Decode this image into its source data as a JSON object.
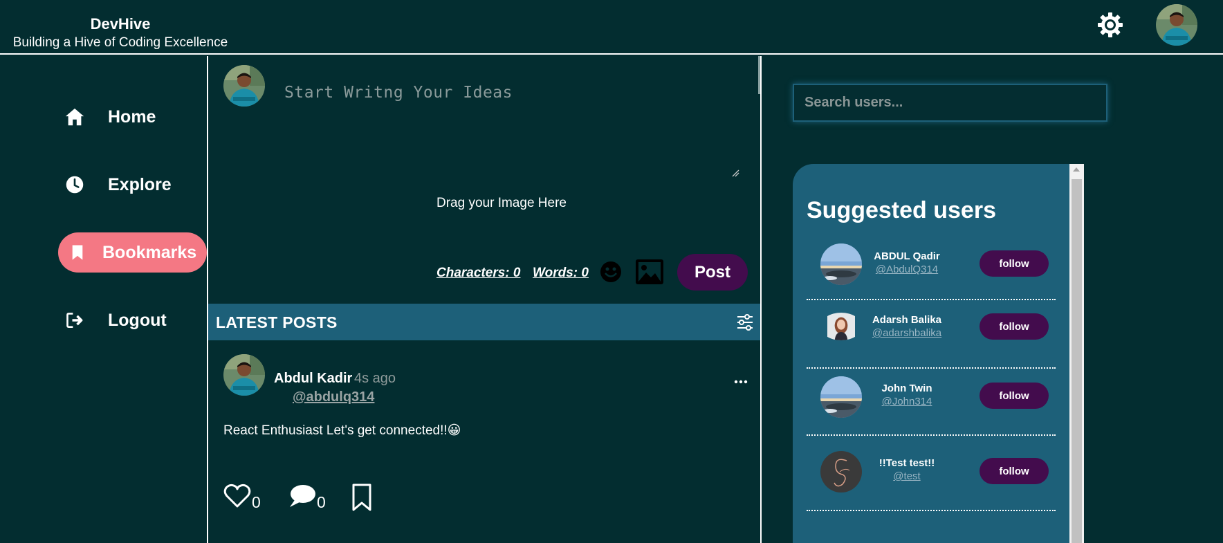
{
  "header": {
    "brand_name": "DevHive",
    "tagline": "Building a Hive of Coding Excellence",
    "settings_icon": "gear-icon",
    "profile_avatar": "user-avatar"
  },
  "sidebar": {
    "items": [
      {
        "label": "Home",
        "icon": "home-icon",
        "active": false
      },
      {
        "label": "Explore",
        "icon": "clock-icon",
        "active": false
      },
      {
        "label": "Bookmarks",
        "icon": "bookmark-icon",
        "active": true
      },
      {
        "label": "Logout",
        "icon": "logout-icon",
        "active": false
      }
    ],
    "active_color": "#f47884"
  },
  "composer": {
    "placeholder": "Start Writng Your Ideas",
    "drag_text": "Drag your Image Here",
    "characters": "Characters: 0",
    "words": "Words: 0",
    "post_label": "Post"
  },
  "feed": {
    "section_title": "LATEST POSTS",
    "posts": [
      {
        "author": "Abdul Kadir",
        "time": "4s ago",
        "handle": "@abdulq314",
        "text": "React Enthusiast Let's get connected!!😀",
        "likes": "0",
        "comments": "0"
      }
    ]
  },
  "search": {
    "placeholder": "Search users..."
  },
  "suggested": {
    "title": "Suggested users",
    "follow_label": "follow",
    "users": [
      {
        "name": "ABDUL Qadir",
        "handle": "@AbdulQ314",
        "avatar": "landscape-avatar"
      },
      {
        "name": "Adarsh Balika",
        "handle": "@adarshbalika",
        "avatar": "portrait-avatar"
      },
      {
        "name": "John Twin",
        "handle": "@John314",
        "avatar": "landscape-avatar"
      },
      {
        "name": "!!Test test!!",
        "handle": "@test",
        "avatar": "signature-avatar"
      }
    ]
  },
  "colors": {
    "background": "#032d30",
    "panel": "#1d6079",
    "button": "#430c4d",
    "accent": "#f47884"
  }
}
